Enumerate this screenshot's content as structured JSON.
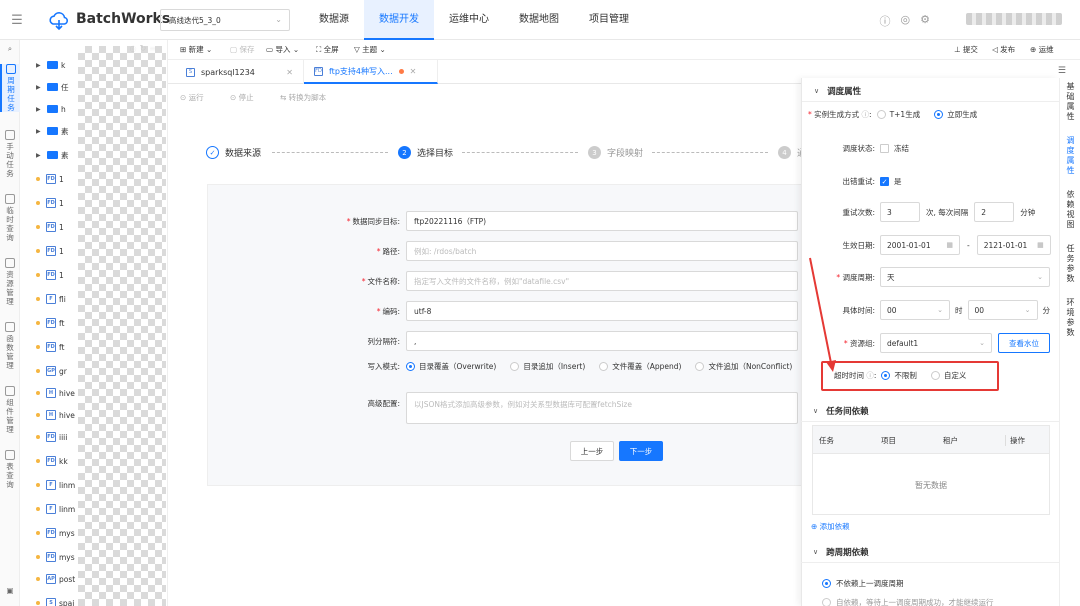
{
  "header": {
    "logo_text": "BatchWorks",
    "project_select": "高线迭代5_3_0",
    "nav": [
      "数据源",
      "数据开发",
      "运维中心",
      "数据地图",
      "项目管理"
    ],
    "active_nav": "数据开发"
  },
  "left_rail": [
    {
      "label": "周\n期\n任\n务",
      "active": true
    },
    {
      "label": "手\n动\n任\n务",
      "active": false
    },
    {
      "label": "临\n时\n查\n询",
      "active": false
    },
    {
      "label": "资\n源\n管\n理",
      "active": false
    },
    {
      "label": "函\n数\n管\n理",
      "active": false
    },
    {
      "label": "组\n件\n管\n理",
      "active": false
    },
    {
      "label": "表\n查\n询",
      "active": false
    }
  ],
  "tree": {
    "rows": [
      {
        "type": "folder",
        "label": "k"
      },
      {
        "type": "folder",
        "label": "任"
      },
      {
        "type": "folder",
        "label": "h"
      },
      {
        "type": "folder",
        "label": "素"
      },
      {
        "type": "folder",
        "label": "素"
      },
      {
        "type": "file",
        "icon": "FD",
        "label": "1"
      },
      {
        "type": "file",
        "icon": "FD",
        "label": "1"
      },
      {
        "type": "file",
        "icon": "FD",
        "label": "1"
      },
      {
        "type": "file",
        "icon": "FD",
        "label": "1"
      },
      {
        "type": "file",
        "icon": "FD",
        "label": "1"
      },
      {
        "type": "file",
        "icon": "F",
        "label": "fli"
      },
      {
        "type": "file",
        "icon": "FD",
        "label": "ft"
      },
      {
        "type": "file",
        "icon": "FD",
        "label": "ft"
      },
      {
        "type": "file",
        "icon": "GP",
        "label": "gr"
      },
      {
        "type": "file",
        "icon": "H",
        "label": "hive"
      },
      {
        "type": "file",
        "icon": "H",
        "label": "hive"
      },
      {
        "type": "file",
        "icon": "FD",
        "label": "iiii"
      },
      {
        "type": "file",
        "icon": "FD",
        "label": "kk"
      },
      {
        "type": "file",
        "icon": "F",
        "label": "linm"
      },
      {
        "type": "file",
        "icon": "F",
        "label": "linm"
      },
      {
        "type": "file",
        "icon": "FD",
        "label": "mys"
      },
      {
        "type": "file",
        "icon": "FD",
        "label": "mys"
      },
      {
        "type": "file",
        "icon": "AP",
        "label": "post"
      },
      {
        "type": "file",
        "icon": "S",
        "label": "spai"
      }
    ]
  },
  "toolbar": {
    "new": "新建",
    "save": "保存",
    "import": "导入",
    "fullscreen": "全屏",
    "theme": "主题",
    "submit": "提交",
    "publish": "发布",
    "ops": "运维"
  },
  "tabs": [
    {
      "icon": "S",
      "label": "sparksql1234",
      "active": false
    },
    {
      "icon": "FD",
      "label": "ftp支持4种写入...",
      "active": true
    }
  ],
  "subbar": {
    "run": "运行",
    "stop": "停止",
    "convert": "转换为脚本"
  },
  "steps": [
    {
      "num": "✓",
      "label": "数据来源",
      "state": "done"
    },
    {
      "num": "2",
      "label": "选择目标",
      "state": "current"
    },
    {
      "num": "3",
      "label": "字段映射",
      "state": "todo"
    },
    {
      "num": "4",
      "label": "通",
      "state": "todo"
    }
  ],
  "form": {
    "target_label": "数据同步目标:",
    "target_value": "ftp20221116（FTP)",
    "path_label": "路径:",
    "path_placeholder": "例如: /rdos/batch",
    "filename_label": "文件名称:",
    "filename_placeholder": "指定写入文件的文件名称，例如\"datafile.csv\"",
    "encoding_label": "编码:",
    "encoding_value": "utf-8",
    "delimiter_label": "列分隔符:",
    "delimiter_value": ",",
    "write_mode_label": "写入模式:",
    "write_modes": [
      {
        "label": "目录覆盖（Overwrite)",
        "checked": true
      },
      {
        "label": "目录追加（Insert)",
        "checked": false
      },
      {
        "label": "文件覆盖（Append)",
        "checked": false
      },
      {
        "label": "文件追加（NonConflict)",
        "checked": false
      }
    ],
    "advanced_label": "高级配置:",
    "advanced_placeholder": "以JSON格式添加高级参数，例如对关系型数据库可配置fetchSize",
    "prev_button": "上一步",
    "next_button": "下一步"
  },
  "right_panel": {
    "schedule_title": "调度属性",
    "instance_label": "实例生成方式",
    "instance_options": [
      {
        "label": "T+1生成",
        "checked": false
      },
      {
        "label": "立即生成",
        "checked": true
      }
    ],
    "status_label": "调度状态:",
    "status_option": "冻结",
    "retry_label": "出错重试:",
    "retry_option": "是",
    "retry_count_label": "重试次数:",
    "retry_count": "3",
    "retry_mid": "次, 每次间隔",
    "retry_interval": "2",
    "retry_unit": "分钟",
    "date_label": "生效日期:",
    "date_start": "2001-01-01",
    "date_sep": "-",
    "date_end": "2121-01-01",
    "period_label": "调度周期:",
    "period_value": "天",
    "time_label": "具体时间:",
    "time_hour": "00",
    "time_hour_unit": "时",
    "time_min": "00",
    "time_min_unit": "分",
    "resource_label": "资源组:",
    "resource_value": "default1",
    "watermark_button": "查看水位",
    "timeout_label": "超时时间",
    "timeout_options": [
      {
        "label": "不限制",
        "checked": true
      },
      {
        "label": "自定义",
        "checked": false
      }
    ],
    "dep_title": "任务间依赖",
    "dep_columns": [
      "任务",
      "项目",
      "租户",
      "操作"
    ],
    "dep_empty": "暂无数据",
    "add_dep": "添加依赖",
    "cross_title": "跨周期依赖",
    "cross_option1": "不依赖上一调度周期",
    "cross_option2": "自依赖，等待上一调度周期成功，才能继续运行"
  },
  "vtabs": [
    {
      "label": "基\n础\n属\n性",
      "active": false
    },
    {
      "label": "调\n度\n属\n性",
      "active": true
    },
    {
      "label": "依\n赖\n视\n图",
      "active": false
    },
    {
      "label": "任\n务\n参\n数",
      "active": false
    },
    {
      "label": "环\n境\n参\n数",
      "active": false
    }
  ],
  "colors": {
    "primary": "#1677ff",
    "annotation_red": "#e53935"
  }
}
